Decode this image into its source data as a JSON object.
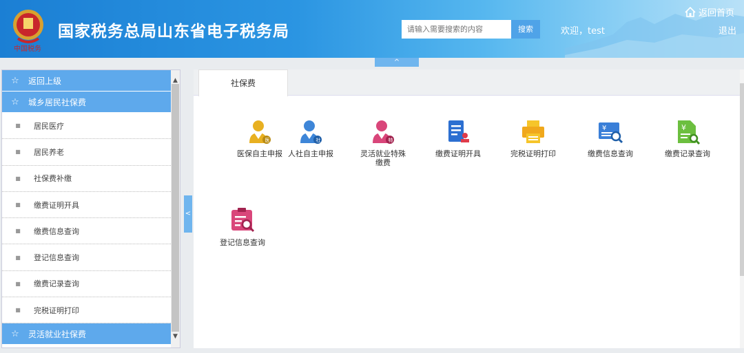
{
  "header": {
    "title": "国家税务总局山东省电子税务局",
    "search_placeholder": "请输入需要搜索的内容",
    "search_button": "搜索",
    "welcome": "欢迎，test",
    "home_link": "返回首页",
    "logout": "退出",
    "collapse_up": "^"
  },
  "sidebar": {
    "back_label": "返回上级",
    "group1": "城乡居民社保费",
    "items": [
      "居民医疗",
      "居民养老",
      "社保费补缴",
      "缴费证明开具",
      "缴费信息查询",
      "登记信息查询",
      "缴费记录查询",
      "完税证明打印"
    ],
    "group2": "灵活就业社保费",
    "collapse_left": "<"
  },
  "main": {
    "tab": "社保费",
    "apps": [
      {
        "label": "医保自主申报",
        "icon": "person-medical-icon"
      },
      {
        "label": "人社自主申报",
        "icon": "person-social-icon"
      },
      {
        "label": "灵活就业特殊缴费",
        "icon": "person-special-icon"
      },
      {
        "label": "缴费证明开具",
        "icon": "certificate-stamp-icon"
      },
      {
        "label": "完税证明打印",
        "icon": "printer-icon"
      },
      {
        "label": "缴费信息查询",
        "icon": "payment-search-icon"
      },
      {
        "label": "缴费记录查询",
        "icon": "record-search-icon"
      },
      {
        "label": "登记信息查询",
        "icon": "registration-search-icon"
      }
    ]
  },
  "colors": {
    "header_blue": "#1b7fd4",
    "sidebar_group": "#5ea9ec",
    "accent": "#4fa3e8"
  }
}
